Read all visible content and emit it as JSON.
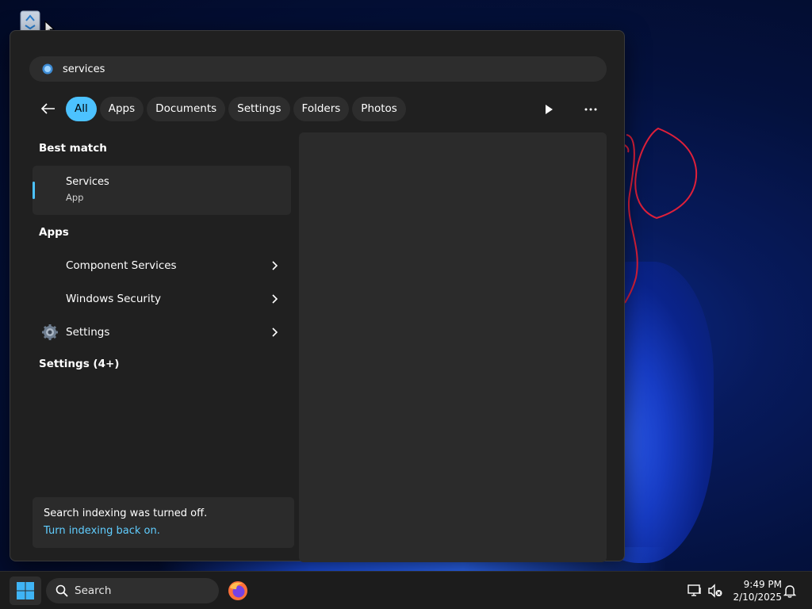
{
  "search": {
    "query": "services"
  },
  "filters": {
    "items": [
      {
        "label": "All",
        "active": true
      },
      {
        "label": "Apps",
        "active": false
      },
      {
        "label": "Documents",
        "active": false
      },
      {
        "label": "Settings",
        "active": false
      },
      {
        "label": "Folders",
        "active": false
      },
      {
        "label": "Photos",
        "active": false
      }
    ]
  },
  "best_match": {
    "heading": "Best match",
    "name": "Services",
    "type": "App"
  },
  "apps": {
    "heading": "Apps",
    "items": [
      {
        "label": "Component Services",
        "icon": "component-services-icon"
      },
      {
        "label": "Windows Security",
        "icon": "windows-security-icon"
      },
      {
        "label": "Settings",
        "icon": "gear-icon"
      }
    ]
  },
  "settings_section": {
    "heading": "Settings (4+)"
  },
  "indexing": {
    "message": "Search indexing was turned off.",
    "link": "Turn indexing back on."
  },
  "taskbar": {
    "search_label": "Search",
    "time": "9:49 PM",
    "date": "2/10/2025"
  },
  "colors": {
    "accent": "#4cc2ff",
    "link": "#60cdff",
    "panel": "#202020"
  }
}
